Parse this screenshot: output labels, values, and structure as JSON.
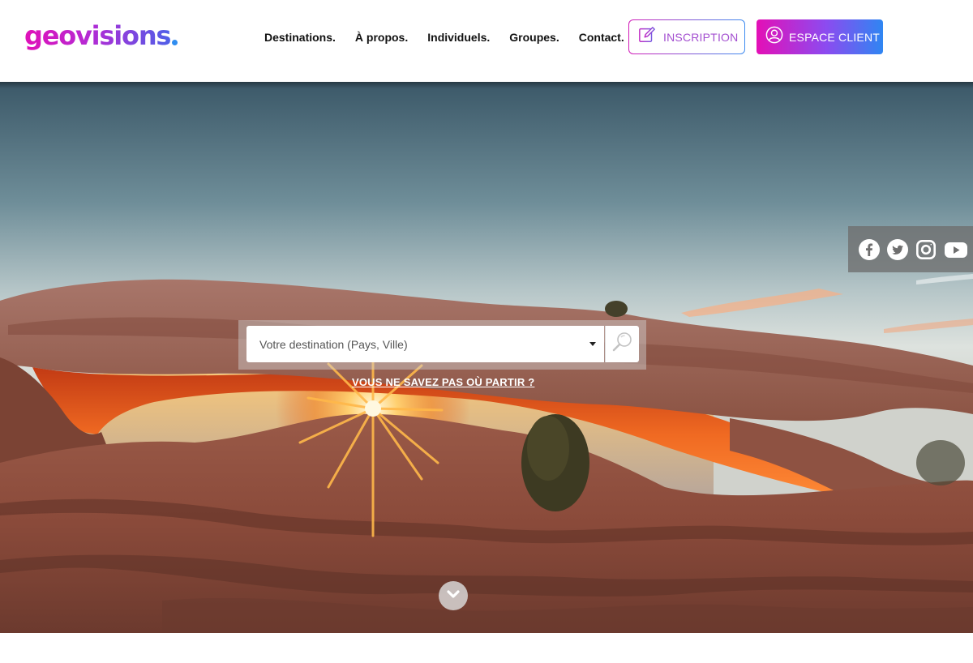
{
  "brand": {
    "name": "geovisions",
    "colors": {
      "pink": "#e40fb6",
      "purple": "#8c4bf0",
      "blue": "#2f86f2"
    }
  },
  "nav": {
    "items": [
      {
        "label": "Destinations."
      },
      {
        "label": "À propos."
      },
      {
        "label": "Individuels."
      },
      {
        "label": "Groupes."
      },
      {
        "label": "Contact."
      }
    ]
  },
  "header": {
    "inscription_label": "INSCRIPTION",
    "inscription_icon": "edit-icon",
    "client_label": "ESPACE CLIENT",
    "client_icon": "user-circle-icon"
  },
  "social": {
    "icons": [
      "facebook-icon",
      "twitter-icon",
      "instagram-icon",
      "youtube-icon"
    ]
  },
  "search": {
    "placeholder": "Votre destination (Pays, Ville)",
    "value": "",
    "button_icon": "search-icon"
  },
  "hero": {
    "hint_link": "VOUS NE SAVEZ PAS OÙ PARTIR ?",
    "scroll_icon": "chevron-down-icon"
  }
}
